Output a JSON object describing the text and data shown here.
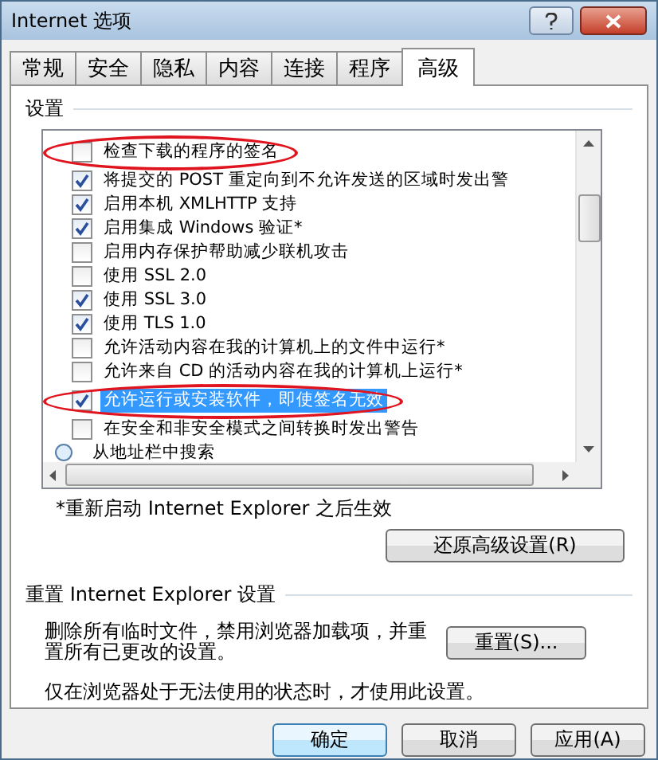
{
  "window": {
    "title": "Internet 选项"
  },
  "tabs": [
    {
      "label": "常规",
      "selected": false
    },
    {
      "label": "安全",
      "selected": false
    },
    {
      "label": "隐私",
      "selected": false
    },
    {
      "label": "内容",
      "selected": false
    },
    {
      "label": "连接",
      "selected": false
    },
    {
      "label": "程序",
      "selected": false
    },
    {
      "label": "高级",
      "selected": true
    }
  ],
  "settings": {
    "label": "设置",
    "rows": [
      {
        "kind": "checkbox",
        "label": "检查下载的程序的签名",
        "checked": false,
        "selected": false,
        "annotated": true
      },
      {
        "kind": "checkbox",
        "label": "将提交的 POST 重定向到不允许发送的区域时发出警",
        "checked": true,
        "selected": false,
        "annotated": false
      },
      {
        "kind": "checkbox",
        "label": "启用本机 XMLHTTP 支持",
        "checked": true,
        "selected": false,
        "annotated": false
      },
      {
        "kind": "checkbox",
        "label": "启用集成 Windows 验证*",
        "checked": true,
        "selected": false,
        "annotated": false
      },
      {
        "kind": "checkbox",
        "label": "启用内存保护帮助减少联机攻击",
        "checked": false,
        "selected": false,
        "annotated": false
      },
      {
        "kind": "checkbox",
        "label": "使用 SSL 2.0",
        "checked": false,
        "selected": false,
        "annotated": false
      },
      {
        "kind": "checkbox",
        "label": "使用 SSL 3.0",
        "checked": true,
        "selected": false,
        "annotated": false
      },
      {
        "kind": "checkbox",
        "label": "使用 TLS 1.0",
        "checked": true,
        "selected": false,
        "annotated": false
      },
      {
        "kind": "checkbox",
        "label": "允许活动内容在我的计算机上的文件中运行*",
        "checked": false,
        "selected": false,
        "annotated": false
      },
      {
        "kind": "checkbox",
        "label": "允许来自 CD 的活动内容在我的计算机上运行*",
        "checked": false,
        "selected": false,
        "annotated": false
      },
      {
        "kind": "checkbox",
        "label": "允许运行或安装软件，即使签名无效",
        "checked": true,
        "selected": true,
        "annotated": true
      },
      {
        "kind": "checkbox",
        "label": "在安全和非安全模式之间转换时发出警告",
        "checked": false,
        "selected": false,
        "annotated": false
      },
      {
        "kind": "group",
        "label": "从地址栏中搜索"
      }
    ],
    "note": "*重新启动 Internet Explorer 之后生效",
    "restore_button": "还原高级设置(R)"
  },
  "reset": {
    "label": "重置 Internet Explorer 设置",
    "description": "删除所有临时文件，禁用浏览器加载项，并重置所有已更改的设置。",
    "button": "重置(S)...",
    "note": "仅在浏览器处于无法使用的状态时，才使用此设置。"
  },
  "buttons": [
    {
      "label": "确定",
      "default": true
    },
    {
      "label": "取消",
      "default": false
    },
    {
      "label": "应用(A)",
      "default": false
    }
  ]
}
